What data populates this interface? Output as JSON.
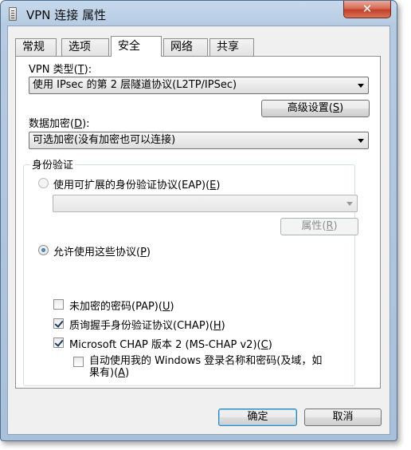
{
  "window": {
    "title": "VPN 连接 属性",
    "close_glyph": "✕"
  },
  "tabs": [
    {
      "label": "常规"
    },
    {
      "label": "选项"
    },
    {
      "label": "安全"
    },
    {
      "label": "网络"
    },
    {
      "label": "共享"
    }
  ],
  "active_tab": "安全",
  "vpn_type": {
    "label": "VPN 类型(",
    "hotkey": "T",
    "label_end": "):",
    "value": "使用 IPsec 的第 2 层隧道协议(L2TP/IPSec)"
  },
  "advanced": {
    "label": "高级设置(",
    "hotkey": "S",
    "label_end": ")"
  },
  "encryption": {
    "label": "数据加密(",
    "hotkey": "D",
    "label_end": "):",
    "value": "可选加密(没有加密也可以连接)"
  },
  "auth": {
    "group_title": "身份验证",
    "eap_radio": {
      "label": "使用可扩展的身份验证协议(EAP)(",
      "hotkey": "E",
      "label_end": ")",
      "selected": false
    },
    "eap_combo_value": "",
    "properties": {
      "label": "属性(",
      "hotkey": "R",
      "label_end": ")"
    },
    "allow_radio": {
      "label": "允许使用这些协议(",
      "hotkey": "P",
      "label_end": ")",
      "selected": true
    },
    "protocols": [
      {
        "label": "未加密的密码(PAP)(",
        "hotkey": "U",
        "label_end": ")",
        "checked": false
      },
      {
        "label": "质询握手身份验证协议(CHAP)(",
        "hotkey": "H",
        "label_end": ")",
        "checked": true
      },
      {
        "label": "Microsoft CHAP 版本 2 (MS-CHAP v2)(",
        "hotkey": "C",
        "label_end": ")",
        "checked": true
      }
    ],
    "auto_logon": {
      "line1": "自动使用我的 Windows 登录名称和密码(及域，如",
      "line2": "果有)(",
      "hotkey": "A",
      "label_end": ")",
      "checked": false
    }
  },
  "buttons": {
    "ok": "确定",
    "cancel": "取消"
  }
}
